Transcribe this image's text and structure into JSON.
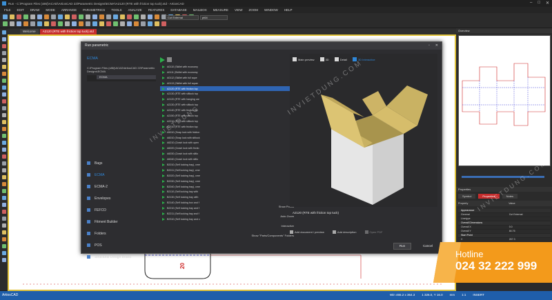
{
  "app": {
    "title": "Run - C:\\Program Files (x86)\\ACAD\\ArtiosCAD 22\\Parametric Designs\\ECMA\\A2120 (RTE with friction top tuck).std - ArtiosCAD"
  },
  "menu": [
    "FILE",
    "EDIT",
    "DRAW",
    "MODE",
    "ARRANGE",
    "PARAMETRICS",
    "TOOLS",
    "ANALYZE",
    "FEATURES",
    "DATABASE",
    "MAILBOX",
    "MEASURE",
    "VIEW",
    "ZOOM",
    "WINDOW",
    "HELP"
  ],
  "toolbar": {
    "linetype_select": "Cut External",
    "pointsize_select": "pt64"
  },
  "doc_tabs": [
    {
      "label": "Welcome",
      "active": false
    },
    {
      "label": "A2120 (RTE with friction top tuck).std",
      "active": true
    }
  ],
  "dialog": {
    "title": "Run parametric",
    "library_head": "ECMA",
    "library_path": "C:\\Program Files (x86)\\ACAD\\ArtiosCAD 22\\Parametric Designs\\ECMA",
    "library_selected": "ECMA",
    "categories": [
      {
        "label": "Bags",
        "active": false
      },
      {
        "label": "ECMA",
        "active": true
      },
      {
        "label": "ECMA-2",
        "active": false
      },
      {
        "label": "Envelopes",
        "active": false
      },
      {
        "label": "FEFCO",
        "active": false
      },
      {
        "label": "Fitment Builder",
        "active": false
      },
      {
        "label": "Folders",
        "active": false
      },
      {
        "label": "POS",
        "active": false
      },
      {
        "label": "Structural Design Board",
        "active": false
      }
    ],
    "standards": [
      "A0110 (Skillet with economy",
      "A0111 (Skillet with economy",
      "A0112 (Skillet with full sque",
      "A0113 (Skillet with full squar",
      "A2120 (RTE with friction top",
      "A2130 (RTE with slitlock top",
      "A2120 (RTE with hanging car",
      "A2130 (RTE with slitlock top",
      "A2140 (RTE with friction top",
      "A2150 (RTE with slitlock top",
      "A2210 (RTE with slitlock top",
      "A2310 (RTE with friction top",
      "A5010 (Snap lock with friction",
      "A6010 (Snap lock with slitlock",
      "A6210 (Crash lock with open",
      "A6020 (Crash lock with frictio",
      "A6030 (Crash lock with slitlo",
      "A6040 (Crash lock with slitlo",
      "B2010 (Self locking tray), cme",
      "B2011 (Self locking tray), cme",
      "B2020 (Self locking tray), cme",
      "B2030 (Self locking tray), cme",
      "B2040 (Self locking tray), cme",
      "B2110 (Self locking tray with",
      "B2130 (Self locking tray with",
      "B2140 (Self locking box and f",
      "B2210 (Self locking tray and f",
      "B2211 (Self locking tray and f",
      "B2310 (Self locking tray and c"
    ],
    "selected_index": 4,
    "options": [
      "Show Points",
      "Auto Zoom",
      "Interactive"
    ],
    "show_parts": "Show \"Parts/Components\" Folders",
    "preview_tabs": [
      "Main preview",
      "3D",
      "Detail",
      "3D Interactive"
    ],
    "active_preview_tab": 3,
    "description": "A2120 (RTE with friction top tuck)",
    "bottom_actions": [
      "Add document / preview",
      "Add description",
      "Open PDF"
    ],
    "run_label": "Run",
    "cancel_label": "Cancel"
  },
  "right_dock": {
    "overview_title": "Overview",
    "properties_title": "Properties",
    "prop_tabs": [
      "Symbol",
      "Properties",
      "Notes"
    ],
    "property_label": "Property",
    "value_label": "Value",
    "properties": [
      {
        "k": "Appearance",
        "v": "",
        "sec": true
      },
      {
        "k": "General",
        "v": "Cut External",
        "sec": false
      },
      {
        "k": "Linetype",
        "v": "",
        "sec": false
      },
      {
        "k": "Overall Dimensions",
        "v": "",
        "sec": true
      },
      {
        "k": "Overall X",
        "v": "0.0",
        "sec": false
      },
      {
        "k": "Overall Y",
        "v": "84.76",
        "sec": false
      },
      {
        "k": "Start Point",
        "v": "",
        "sec": true
      },
      {
        "k": "X",
        "v": "267.3",
        "sec": false
      },
      {
        "k": "Y",
        "v": "2.427",
        "sec": false
      },
      {
        "k": "End Point",
        "v": "",
        "sec": true
      },
      {
        "k": "X",
        "v": "267.3",
        "sec": false
      },
      {
        "k": "Y",
        "v": "-82.35",
        "sec": false
      },
      {
        "k": "Misc",
        "v": "",
        "sec": true
      },
      {
        "k": "Length",
        "v": "84.76",
        "sec": false
      }
    ]
  },
  "status": {
    "left": "ArtiosCAD",
    "coords": "Win 465.2 x 364.3",
    "scale": "1 326.0, Y 16.0",
    "units": "mm",
    "zoom": "1:1",
    "mode": "INSERT"
  },
  "canvas": {
    "dimension_label": "20"
  },
  "overlay": {
    "watermark": "INVIETDUNG.COM",
    "watermark_small": "INVIETDUNG",
    "hotline_title": "Hotline",
    "hotline_number": "024 32 222 999"
  },
  "colors": {
    "accent_blue": "#2f87d8",
    "active_tab_red": "#c62d2d",
    "canvas_border": "#e1c33a",
    "hotline_orange": "#f39a1b",
    "run_icon_green": "#2bb14a",
    "box_inside": "#c9b263",
    "box_outside": "#dcdcdc"
  }
}
